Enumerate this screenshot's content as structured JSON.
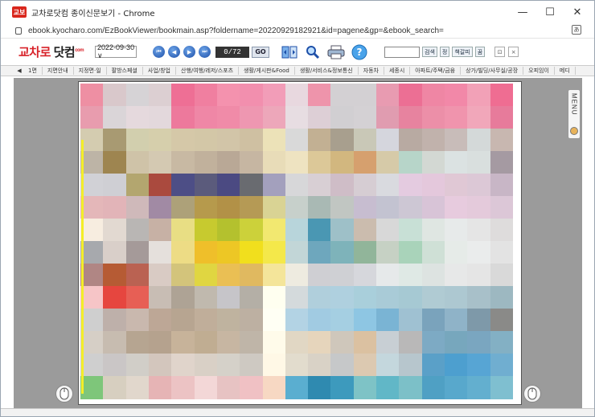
{
  "window": {
    "app_icon": "교보",
    "title": "교차로닷컴 종이신문보기 - Chrome",
    "controls": {
      "minimize": "—",
      "maximize": "☐",
      "close": "✕"
    }
  },
  "address": {
    "url": "ebook.kyocharo.com/EzBookViewer/bookmain.asp?foldername=20220929182921&id=pagene&gp=&ebook_search="
  },
  "toolbar": {
    "logo_text": "교차로",
    "logo_sub": "닷컴",
    "logo_badge": "com",
    "date_value": "2022-09-30 ∨",
    "page_indicator": "0/72",
    "go_label": "GO",
    "search_value": "",
    "search_button": "검색",
    "btn_small_1": "정",
    "btn_small_2": "책갈피",
    "btn_small_3": "꿈",
    "btn_small_4": "⊡",
    "btn_small_5": "×"
  },
  "sections": [
    "1면",
    "지면안내",
    "지정면·일",
    "팔방스페셜",
    "사업/창업",
    "산행/여행/레저/스포츠",
    "생활/게시판&Food",
    "생활/서비스&정보통신",
    "자동차",
    "세종시",
    "아파트/주택/금융",
    "상가/빌딩/사무실/공장",
    "오피임이",
    "메디"
  ],
  "viewer": {
    "menu_label": "MENU"
  },
  "colors": {
    "accent": "#d8232a",
    "nav_blue": "#1d4fa8",
    "viewer_bg": "#9b9b9b"
  }
}
